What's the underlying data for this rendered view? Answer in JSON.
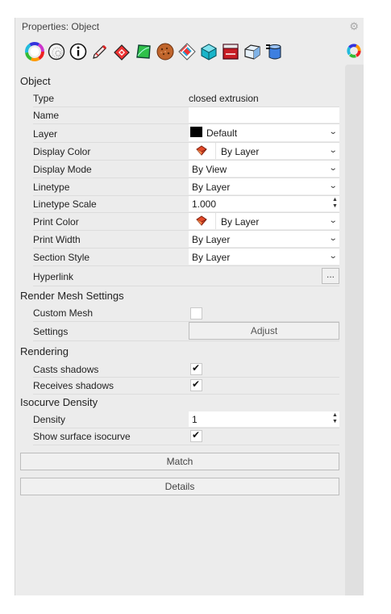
{
  "panel": {
    "title": "Properties: Object"
  },
  "icons": [
    "material-color-wheel-icon",
    "texture-mapping-icon",
    "object-info-icon",
    "pen-curve-icon",
    "decal-icon",
    "green-surface-icon",
    "cookie-texture-icon",
    "puzzle-grid-icon",
    "cyan-box-icon",
    "red-render-icon",
    "wireframe-box-icon",
    "database-layers-icon",
    "color-wheel-small-icon"
  ],
  "sections": {
    "object": "Object",
    "render_mesh": "Render Mesh Settings",
    "rendering": "Rendering",
    "isocurve": "Isocurve Density"
  },
  "object": {
    "type_label": "Type",
    "type_value": "closed extrusion",
    "name_label": "Name",
    "name_value": "",
    "layer_label": "Layer",
    "layer_value": "Default",
    "layer_color": "#000000",
    "display_color_label": "Display Color",
    "display_color_value": "By Layer",
    "display_mode_label": "Display Mode",
    "display_mode_value": "By View",
    "linetype_label": "Linetype",
    "linetype_value": "By Layer",
    "linetype_scale_label": "Linetype Scale",
    "linetype_scale_value": "1.000",
    "print_color_label": "Print Color",
    "print_color_value": "By Layer",
    "print_width_label": "Print Width",
    "print_width_value": "By Layer",
    "section_style_label": "Section Style",
    "section_style_value": "By Layer",
    "hyperlink_label": "Hyperlink",
    "hyperlink_button": "..."
  },
  "render_mesh": {
    "custom_mesh_label": "Custom Mesh",
    "custom_mesh_checked": false,
    "settings_label": "Settings",
    "adjust_button": "Adjust"
  },
  "rendering": {
    "casts_shadows_label": "Casts shadows",
    "casts_shadows_checked": true,
    "receives_shadows_label": "Receives shadows",
    "receives_shadows_checked": true
  },
  "isocurve": {
    "density_label": "Density",
    "density_value": "1",
    "show_isocurve_label": "Show surface isocurve",
    "show_isocurve_checked": true
  },
  "buttons": {
    "match": "Match",
    "details": "Details"
  },
  "glyphs": {
    "check": "✔",
    "chevron": "⌄",
    "up": "▲",
    "down": "▼",
    "gear": "⚙"
  }
}
